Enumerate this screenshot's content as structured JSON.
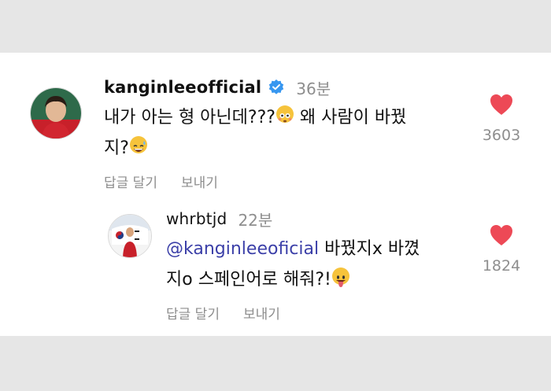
{
  "thread": {
    "comment": {
      "username": "kanginleeofficial",
      "time": "36분",
      "text_line1": "내가 아는 형 아닌데???",
      "text_line1b": " 왜 사람이 바꿨",
      "text_line2": "지?",
      "reply_label": "답글 달기",
      "send_label": "보내기",
      "like_count": "3603",
      "emoji1": "flushed-face",
      "emoji2": "grinning-sweat-face"
    },
    "reply": {
      "username": "whrbtjd",
      "time": "22분",
      "mention": "@kanginleeoficial",
      "text_line1": " 바꿨지x 바꼈",
      "text_line2": "지o 스페인어로 해줘?!",
      "reply_label": "답글 달기",
      "send_label": "보내기",
      "like_count": "1824",
      "emoji1": "tongue-face"
    }
  },
  "colors": {
    "heart": "#ed4956",
    "verified": "#3797f0",
    "muted": "#8e8e8e",
    "mention": "#3b3fa8",
    "background": "#e6e6e6"
  }
}
